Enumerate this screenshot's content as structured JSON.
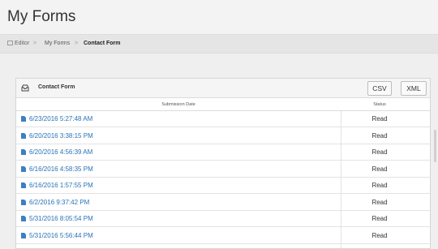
{
  "header": {
    "title": "My Forms"
  },
  "breadcrumb": {
    "editor": "Editor",
    "sep": ">",
    "my_forms": "My Forms",
    "current": "Contact Form"
  },
  "panel": {
    "title": "Contact Form",
    "csv_label": "CSV",
    "xml_label": "XML",
    "columns": [
      "Submission Date",
      "Status"
    ],
    "rows": [
      {
        "date": "6/23/2016 5:27:48 AM",
        "status": "Read"
      },
      {
        "date": "6/20/2016 3:38:15 PM",
        "status": "Read"
      },
      {
        "date": "6/20/2016 4:56:39 AM",
        "status": "Read"
      },
      {
        "date": "6/16/2016 4:58:35 PM",
        "status": "Read"
      },
      {
        "date": "6/16/2016 1:57:55 PM",
        "status": "Read"
      },
      {
        "date": "6/2/2016 9:37:42 PM",
        "status": "Read"
      },
      {
        "date": "5/31/2016 8:05:54 PM",
        "status": "Read"
      },
      {
        "date": "5/31/2016 5:56:44 PM",
        "status": "Read"
      }
    ]
  },
  "colors": {
    "link": "#2a72b5",
    "doc_icon": "#3f7fc1"
  },
  "icons": {
    "panel": "inbox-icon",
    "row": "document-icon",
    "breadcrumb": "edit-icon"
  }
}
